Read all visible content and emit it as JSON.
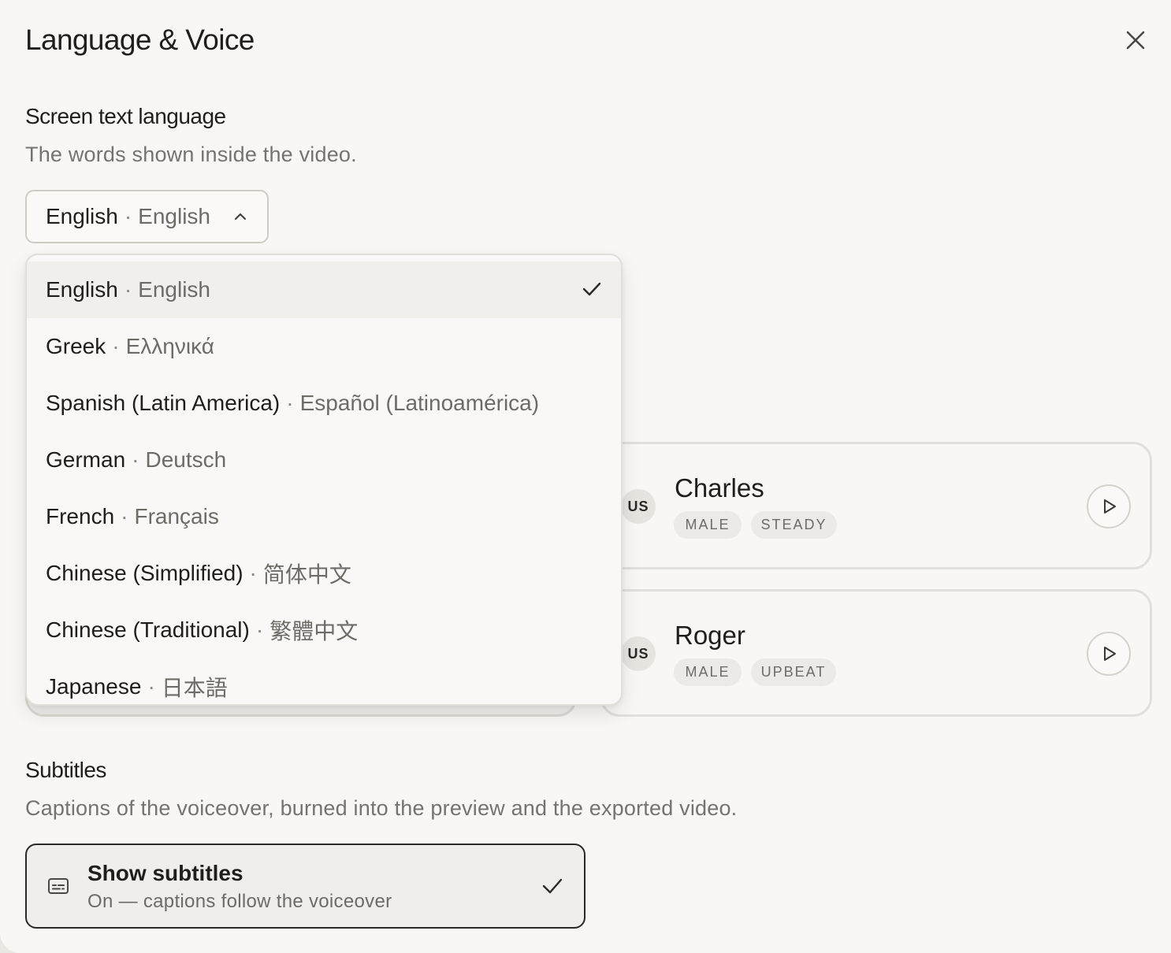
{
  "dialog": {
    "title": "Language & Voice"
  },
  "screen_text": {
    "title": "Screen text language",
    "description": "The words shown inside the video.",
    "selected": {
      "name": "English",
      "native": "English"
    }
  },
  "languages": [
    {
      "name": "English",
      "native": "English",
      "selected": true
    },
    {
      "name": "Greek",
      "native": "Ελληνικά"
    },
    {
      "name": "Spanish (Latin America)",
      "native": "Español (Latinoamérica)"
    },
    {
      "name": "German",
      "native": "Deutsch"
    },
    {
      "name": "French",
      "native": "Français"
    },
    {
      "name": "Chinese (Simplified)",
      "native": "简体中文"
    },
    {
      "name": "Chinese (Traditional)",
      "native": "繁體中文"
    },
    {
      "name": "Japanese",
      "native": "日本語"
    }
  ],
  "voices": [
    {
      "flag": "US",
      "name": "Charles",
      "tags": [
        "MALE",
        "STEADY"
      ]
    },
    {
      "flag": "US",
      "name": "Roger",
      "tags": [
        "MALE",
        "UPBEAT"
      ]
    }
  ],
  "subtitles": {
    "title": "Subtitles",
    "description": "Captions of the voiceover, burned into the preview and the exported video.",
    "option_title": "Show subtitles",
    "option_desc": "On — captions follow the voiceover"
  },
  "icons": {
    "close": "close-icon",
    "chevron": "chevron-up-icon",
    "check": "check-icon",
    "play": "play-icon",
    "subtitles": "subtitles-icon"
  },
  "colors": {
    "background": "#f8f7f4",
    "text": "#1f1e1c",
    "muted": "#76736e",
    "border": "#cfccc6"
  }
}
